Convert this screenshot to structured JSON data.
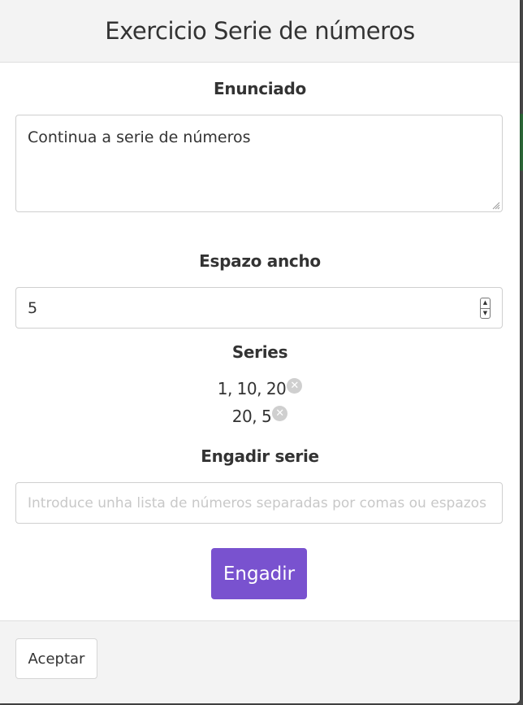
{
  "modal": {
    "title": "Exercicio Serie de números"
  },
  "statement": {
    "label": "Enunciado",
    "value": "Continua a serie de números"
  },
  "width": {
    "label": "Espazo ancho",
    "value": "5"
  },
  "series": {
    "label": "Series",
    "items": [
      "1, 10, 20",
      "20, 5"
    ],
    "remove_icon": "times-circle-icon"
  },
  "add_series": {
    "label": "Engadir serie",
    "placeholder": "Introduce unha lista de números separadas por comas ou espazos",
    "button_label": "Engadir",
    "button_color": "#7952cf"
  },
  "footer": {
    "accept_label": "Aceptar"
  }
}
